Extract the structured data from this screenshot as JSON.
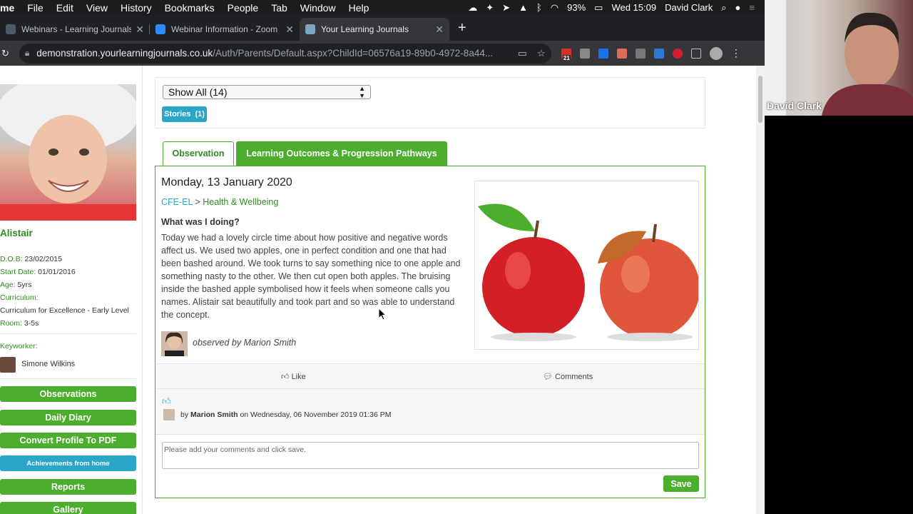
{
  "menubar": {
    "app": "me",
    "items": [
      "File",
      "Edit",
      "View",
      "History",
      "Bookmarks",
      "People",
      "Tab",
      "Window",
      "Help"
    ],
    "battery": "93%",
    "clock": "Wed 15:09",
    "user": "David Clark"
  },
  "tabs": [
    {
      "title": "Webinars - Learning Journals",
      "color": "#2aa6c9"
    },
    {
      "title": "Webinar Information - Zoom",
      "color": "#2d8cff"
    },
    {
      "title": "Your Learning Journals",
      "color": "#2aa6c9"
    }
  ],
  "address": {
    "host": "demonstration.yourlearningjournals.co.uk",
    "path": "/Auth/Parents/Default.aspx?ChildId=06576a19-89b0-4972-8a44..."
  },
  "extensions": {
    "badge": "21"
  },
  "child": {
    "name": "Alistair",
    "dob_label": "D.O.B:",
    "dob": "23/02/2015",
    "start_label": "Start Date:",
    "start": "01/01/2016",
    "age_label": "Age:",
    "age": "5yrs",
    "curriculum_label": "Curriculum:",
    "curriculum": "Curriculum for Excellence - Early Level",
    "room_label": "Room:",
    "room": "3-5s",
    "keyworker_label": "Keyworker:",
    "keyworker": "Simone Wilkins"
  },
  "sidebar_buttons": [
    "Observations",
    "Daily Diary",
    "Convert Profile To PDF",
    "Achievements from home",
    "Reports",
    "Gallery"
  ],
  "filter": {
    "select_value": "Show All (14)",
    "stories_label": "Stories",
    "stories_count": "(1)"
  },
  "panel_tabs": {
    "observation": "Observation",
    "outcomes": "Learning Outcomes & Progression Pathways"
  },
  "observation": {
    "date": "Monday, 13 January 2020",
    "crumb_a": "CFE-EL",
    "crumb_sep": " > ",
    "crumb_b": "Health & Wellbeing",
    "question": "What was I doing?",
    "text": "Today we had a lovely circle time about how positive and negative words affect us. We used two apples, one in perfect condition and one that had been bashed around. We took turns to say something nice to one apple and something nasty to the other. We then cut open both apples. The bruising inside the bashed apple symbolised how it feels when someone calls you names. Alistair sat beautifully and took part and so was able to understand the concept.",
    "observed_by": "observed by Marion Smith"
  },
  "actions": {
    "like": "Like",
    "comments": "Comments"
  },
  "like_entry": {
    "prefix": "by",
    "name": "Marion Smith",
    "suffix": "on Wednesday, 06 November 2019 01:36 PM"
  },
  "comment": {
    "placeholder": "Please add your comments and click save.",
    "save": "Save"
  },
  "video": {
    "name": "David Clark"
  },
  "colors": {
    "green": "#4cae2d",
    "green_text": "#2e8b20",
    "blue": "#2aa6c9"
  }
}
